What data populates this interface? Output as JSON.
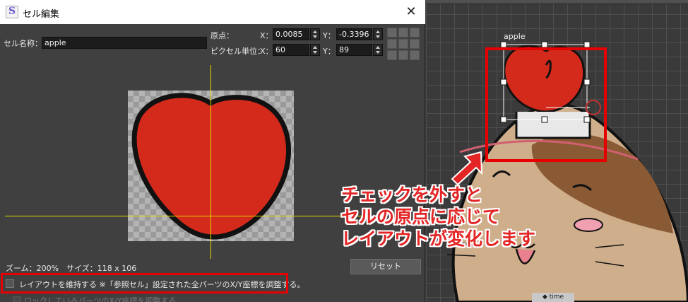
{
  "dialog": {
    "title": "セル編集",
    "close_glyph": "✕",
    "cell_name_label": "セル名称：",
    "cell_name_value": "apple",
    "origin_label": "原点：",
    "pixel_unit_label": "ピクセル単位：",
    "x_label": "X：",
    "y_label": "Y：",
    "origin_x": "0.0085",
    "origin_y": "-0.3396",
    "pixel_x": "60",
    "pixel_y": "89",
    "zoom_text": "ズーム：200%　サイズ：118 x 106",
    "reset_label": "リセット",
    "keep_layout_label": "レイアウトを維持する ※「参照セル」設定された全パーツのX/Y座標を調整する。",
    "locked_parts_label": "ロックしているパーツのX/Y座標を調整する"
  },
  "canvas": {
    "cell_label": "apple",
    "time_tab": "◆ time"
  },
  "annotation": {
    "lines": [
      "チェックを外すと",
      "セルの原点に応じて",
      "レイアウトが変化します"
    ]
  },
  "colors": {
    "accent_red": "#e60000",
    "apple_red": "#d42a1c",
    "crosshair": "#e5d700",
    "dialog_bg": "#404040"
  },
  "icons": [
    "app-icon",
    "close-icon",
    "spin-up-down-icon",
    "grid-align-icon",
    "checkbox-icon",
    "arrow-icon"
  ]
}
